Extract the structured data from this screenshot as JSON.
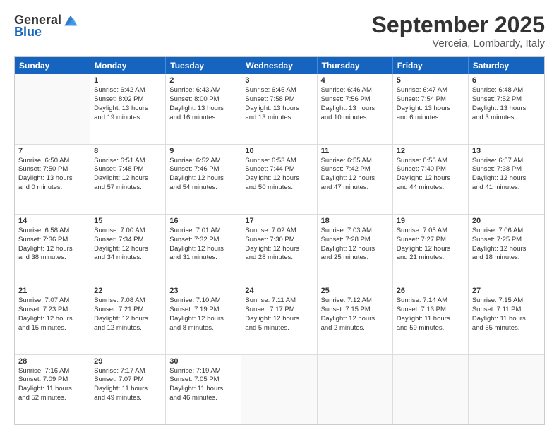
{
  "header": {
    "logo_general": "General",
    "logo_blue": "Blue",
    "month_title": "September 2025",
    "location": "Verceia, Lombardy, Italy"
  },
  "days_of_week": [
    "Sunday",
    "Monday",
    "Tuesday",
    "Wednesday",
    "Thursday",
    "Friday",
    "Saturday"
  ],
  "weeks": [
    {
      "cells": [
        {
          "empty": true
        },
        {
          "day": "1",
          "lines": [
            "Sunrise: 6:42 AM",
            "Sunset: 8:02 PM",
            "Daylight: 13 hours",
            "and 19 minutes."
          ]
        },
        {
          "day": "2",
          "lines": [
            "Sunrise: 6:43 AM",
            "Sunset: 8:00 PM",
            "Daylight: 13 hours",
            "and 16 minutes."
          ]
        },
        {
          "day": "3",
          "lines": [
            "Sunrise: 6:45 AM",
            "Sunset: 7:58 PM",
            "Daylight: 13 hours",
            "and 13 minutes."
          ]
        },
        {
          "day": "4",
          "lines": [
            "Sunrise: 6:46 AM",
            "Sunset: 7:56 PM",
            "Daylight: 13 hours",
            "and 10 minutes."
          ]
        },
        {
          "day": "5",
          "lines": [
            "Sunrise: 6:47 AM",
            "Sunset: 7:54 PM",
            "Daylight: 13 hours",
            "and 6 minutes."
          ]
        },
        {
          "day": "6",
          "lines": [
            "Sunrise: 6:48 AM",
            "Sunset: 7:52 PM",
            "Daylight: 13 hours",
            "and 3 minutes."
          ]
        }
      ]
    },
    {
      "cells": [
        {
          "day": "7",
          "lines": [
            "Sunrise: 6:50 AM",
            "Sunset: 7:50 PM",
            "Daylight: 13 hours",
            "and 0 minutes."
          ]
        },
        {
          "day": "8",
          "lines": [
            "Sunrise: 6:51 AM",
            "Sunset: 7:48 PM",
            "Daylight: 12 hours",
            "and 57 minutes."
          ]
        },
        {
          "day": "9",
          "lines": [
            "Sunrise: 6:52 AM",
            "Sunset: 7:46 PM",
            "Daylight: 12 hours",
            "and 54 minutes."
          ]
        },
        {
          "day": "10",
          "lines": [
            "Sunrise: 6:53 AM",
            "Sunset: 7:44 PM",
            "Daylight: 12 hours",
            "and 50 minutes."
          ]
        },
        {
          "day": "11",
          "lines": [
            "Sunrise: 6:55 AM",
            "Sunset: 7:42 PM",
            "Daylight: 12 hours",
            "and 47 minutes."
          ]
        },
        {
          "day": "12",
          "lines": [
            "Sunrise: 6:56 AM",
            "Sunset: 7:40 PM",
            "Daylight: 12 hours",
            "and 44 minutes."
          ]
        },
        {
          "day": "13",
          "lines": [
            "Sunrise: 6:57 AM",
            "Sunset: 7:38 PM",
            "Daylight: 12 hours",
            "and 41 minutes."
          ]
        }
      ]
    },
    {
      "cells": [
        {
          "day": "14",
          "lines": [
            "Sunrise: 6:58 AM",
            "Sunset: 7:36 PM",
            "Daylight: 12 hours",
            "and 38 minutes."
          ]
        },
        {
          "day": "15",
          "lines": [
            "Sunrise: 7:00 AM",
            "Sunset: 7:34 PM",
            "Daylight: 12 hours",
            "and 34 minutes."
          ]
        },
        {
          "day": "16",
          "lines": [
            "Sunrise: 7:01 AM",
            "Sunset: 7:32 PM",
            "Daylight: 12 hours",
            "and 31 minutes."
          ]
        },
        {
          "day": "17",
          "lines": [
            "Sunrise: 7:02 AM",
            "Sunset: 7:30 PM",
            "Daylight: 12 hours",
            "and 28 minutes."
          ]
        },
        {
          "day": "18",
          "lines": [
            "Sunrise: 7:03 AM",
            "Sunset: 7:28 PM",
            "Daylight: 12 hours",
            "and 25 minutes."
          ]
        },
        {
          "day": "19",
          "lines": [
            "Sunrise: 7:05 AM",
            "Sunset: 7:27 PM",
            "Daylight: 12 hours",
            "and 21 minutes."
          ]
        },
        {
          "day": "20",
          "lines": [
            "Sunrise: 7:06 AM",
            "Sunset: 7:25 PM",
            "Daylight: 12 hours",
            "and 18 minutes."
          ]
        }
      ]
    },
    {
      "cells": [
        {
          "day": "21",
          "lines": [
            "Sunrise: 7:07 AM",
            "Sunset: 7:23 PM",
            "Daylight: 12 hours",
            "and 15 minutes."
          ]
        },
        {
          "day": "22",
          "lines": [
            "Sunrise: 7:08 AM",
            "Sunset: 7:21 PM",
            "Daylight: 12 hours",
            "and 12 minutes."
          ]
        },
        {
          "day": "23",
          "lines": [
            "Sunrise: 7:10 AM",
            "Sunset: 7:19 PM",
            "Daylight: 12 hours",
            "and 8 minutes."
          ]
        },
        {
          "day": "24",
          "lines": [
            "Sunrise: 7:11 AM",
            "Sunset: 7:17 PM",
            "Daylight: 12 hours",
            "and 5 minutes."
          ]
        },
        {
          "day": "25",
          "lines": [
            "Sunrise: 7:12 AM",
            "Sunset: 7:15 PM",
            "Daylight: 12 hours",
            "and 2 minutes."
          ]
        },
        {
          "day": "26",
          "lines": [
            "Sunrise: 7:14 AM",
            "Sunset: 7:13 PM",
            "Daylight: 11 hours",
            "and 59 minutes."
          ]
        },
        {
          "day": "27",
          "lines": [
            "Sunrise: 7:15 AM",
            "Sunset: 7:11 PM",
            "Daylight: 11 hours",
            "and 55 minutes."
          ]
        }
      ]
    },
    {
      "cells": [
        {
          "day": "28",
          "lines": [
            "Sunrise: 7:16 AM",
            "Sunset: 7:09 PM",
            "Daylight: 11 hours",
            "and 52 minutes."
          ]
        },
        {
          "day": "29",
          "lines": [
            "Sunrise: 7:17 AM",
            "Sunset: 7:07 PM",
            "Daylight: 11 hours",
            "and 49 minutes."
          ]
        },
        {
          "day": "30",
          "lines": [
            "Sunrise: 7:19 AM",
            "Sunset: 7:05 PM",
            "Daylight: 11 hours",
            "and 46 minutes."
          ]
        },
        {
          "empty": true
        },
        {
          "empty": true
        },
        {
          "empty": true
        },
        {
          "empty": true
        }
      ]
    }
  ]
}
